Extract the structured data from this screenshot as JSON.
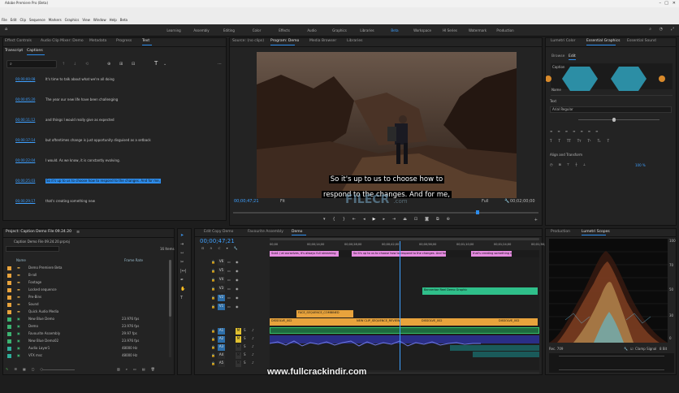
{
  "titlebar": {
    "title": "Adobe Premiere Pro (Beta)"
  },
  "menubar": [
    "File",
    "Edit",
    "Clip",
    "Sequence",
    "Markers",
    "Graphics",
    "View",
    "Window",
    "Help",
    "Beta"
  ],
  "workspaces": [
    "Learning",
    "Assembly",
    "Editing",
    "Color",
    "Effects",
    "Audio",
    "Graphics",
    "Libraries",
    "Beta",
    "Workspace",
    "HI Series",
    "Watermark",
    "Production"
  ],
  "text_panel": {
    "tabs": [
      "Effect Controls",
      "Audio Clip Mixer: Demo",
      "Metadata",
      "Progress",
      "Text"
    ],
    "subtabs": [
      "Transcript",
      "Captions"
    ],
    "captions": [
      {
        "tc": "00;00;00;08",
        "text": "It's time to talk about what we're all doing"
      },
      {
        "tc": "00;00;05;20",
        "text": "The year our new life have been challenging"
      },
      {
        "tc": "00;00;11;12",
        "text": "and things I would really give as expected"
      },
      {
        "tc": "00;00;17;14",
        "text": "but oftentimes change is just opportunity disguised as a setback"
      },
      {
        "tc": "00;00;22;04",
        "text": "I would. As we know, it is constantly evolving."
      },
      {
        "tc": "00;00;25;03",
        "text": "So it's up to us to choose how to respond to the changes. And for me,"
      },
      {
        "tc": "00;00;29;17",
        "text": "that's creating something new"
      }
    ]
  },
  "program": {
    "tabs": [
      "Source: (no clips)",
      "Program: Demo",
      "Media Browser",
      "Libraries"
    ],
    "timecode": "00;00;47;21",
    "fit": "Fit",
    "scale": "Full",
    "duration": "00;02;00;00",
    "subtitle": [
      "So it's up to us to choose how to",
      "respond to the changes. And for me,"
    ],
    "watermark": "FILECR",
    "watermark_sub": ".com"
  },
  "essential_graphics": {
    "tabs": [
      "Lumetri Color",
      "Essential Graphics",
      "Essential Sound"
    ],
    "subtabs": [
      "Browse",
      "Edit"
    ],
    "layer": "Caption",
    "name_label": "Name",
    "text_label": "Text",
    "font": "Arial Regular",
    "align_label": "Align and Transform",
    "opacity": "100 %"
  },
  "project": {
    "title": "Project: Caption Demo File 09.24.20",
    "file": "Caption Demo File 09.24.20.prproj",
    "count": "16 Items",
    "col_name": "Name",
    "col_rate": "Frame Rate",
    "items": [
      {
        "name": "Demo Premiere Beta",
        "rate": "",
        "color": "#e8a33c",
        "folder": true
      },
      {
        "name": "B-roll",
        "rate": "",
        "color": "#e8a33c",
        "folder": true
      },
      {
        "name": "Footage",
        "rate": "",
        "color": "#e8a33c",
        "folder": true
      },
      {
        "name": "Locked sequence",
        "rate": "",
        "color": "#e8a33c",
        "folder": true
      },
      {
        "name": "Pre-Bins",
        "rate": "",
        "color": "#e8a33c",
        "folder": true
      },
      {
        "name": "Sound",
        "rate": "",
        "color": "#e8a33c",
        "folder": true
      },
      {
        "name": "Quick Audio Media",
        "rate": "",
        "color": "#e8a33c",
        "folder": true
      },
      {
        "name": "New Blue Demo",
        "rate": "23.976 fps",
        "color": "#3cb371",
        "folder": false
      },
      {
        "name": "Demo",
        "rate": "23.976 fps",
        "color": "#3cb371",
        "folder": false
      },
      {
        "name": "Favourite Assembly",
        "rate": "29.97 fps",
        "color": "#3cb371",
        "folder": false
      },
      {
        "name": "New Blue Demo02",
        "rate": "23.976 fps",
        "color": "#3cb371",
        "folder": false
      },
      {
        "name": "Audio Layer1",
        "rate": "48000 Hz",
        "color": "#2fae9a",
        "folder": false
      },
      {
        "name": "VFX msc",
        "rate": "48000 Hz",
        "color": "#2fae9a",
        "folder": false
      }
    ]
  },
  "timeline": {
    "tabs": [
      "Edit Copy Demo",
      "Favourite Assembly",
      "Demo"
    ],
    "timecode": "00;00;47;21",
    "ruler": [
      "00;00",
      "00;00;14;00",
      "00;00;28;00",
      "00;00;42;00",
      "00;00;56;00",
      "00;01;10;00",
      "00;01;24;00",
      "00;01;38;00"
    ],
    "tracks_v": [
      "V6",
      "V5",
      "V4",
      "V3",
      "V2",
      "V1"
    ],
    "tracks_a": [
      "A1",
      "A2",
      "A3",
      "A4",
      "A5"
    ],
    "clips": {
      "cap1": "Sub1 / at ourselves, it's always full streaming",
      "cap2": "So it's up to us to choose how to respond to the changes. And for me,",
      "cap3": "that's creating something new",
      "graphic": "Bannerbar Reel Demo Graphic",
      "vid_title": "FACE_SEQUENCE_COMBINED",
      "v1a": "DISSOLVE_002",
      "v1b": "NEW CLIP_SEQUENCE_REVIEW",
      "v1c": "DISSOLVE_002",
      "v1d": "DISSOLVE_002"
    }
  },
  "scopes": {
    "tabs": [
      "Production",
      "Lumetri Scopes"
    ],
    "scale": "8 Bit",
    "clamp": "Clamp Signal",
    "mode": "Rec. 709"
  },
  "footer_text": "www.fullcrackindir.com"
}
